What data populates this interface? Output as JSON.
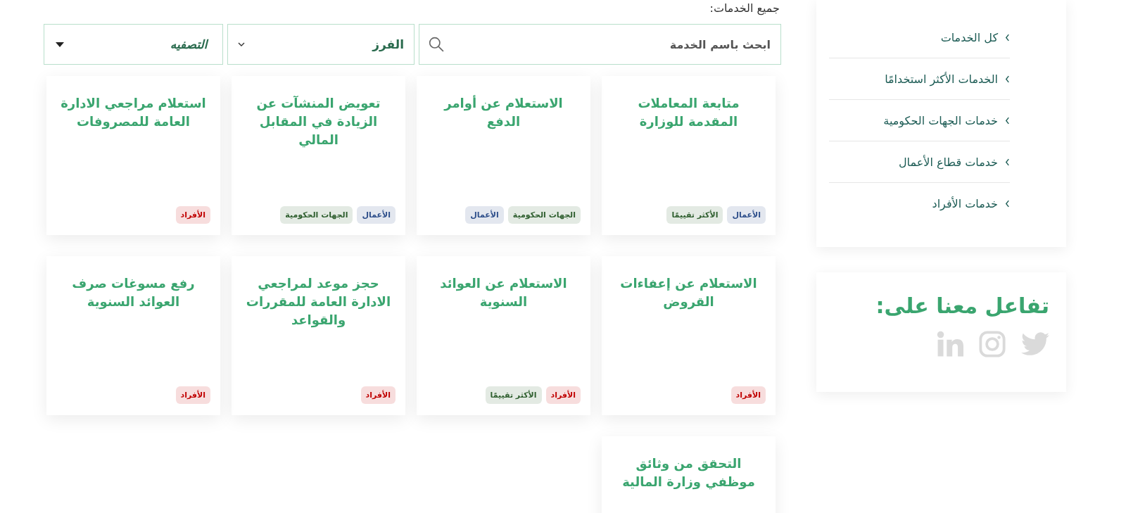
{
  "main": {
    "heading": "جميع الخدمات:",
    "search": {
      "placeholder": "ابحث باسم الخدمة"
    },
    "sort": {
      "value": "الفرز"
    },
    "filter": {
      "value": "التصفيه"
    },
    "services": [
      {
        "title": "متابعة المعاملات المقدمة للوزارة",
        "tags": [
          {
            "label": "الأعمال",
            "color": "#2d4e8a"
          },
          {
            "label": "الأكثر تقييمًا",
            "color": "#2e5e2e"
          }
        ]
      },
      {
        "title": "الاستعلام عن أوامر الدفع",
        "tags": [
          {
            "label": "الجهات الحكومية",
            "color": "#2e5e2e"
          },
          {
            "label": "الأعمال",
            "color": "#2d4e8a"
          }
        ]
      },
      {
        "title": "تعويض المنشآت عن الزيادة في المقابل المالي",
        "tags": [
          {
            "label": "الأعمال",
            "color": "#2d4e8a"
          },
          {
            "label": "الجهات الحكومية",
            "color": "#2e5e2e"
          }
        ]
      },
      {
        "title": "استعلام مراجعي الادارة العامة للمصروفات",
        "tags": [
          {
            "label": "الأفراد",
            "color": "#c00000"
          }
        ]
      },
      {
        "title": "الاستعلام عن إعفاءات القروض",
        "tags": [
          {
            "label": "الأفراد",
            "color": "#c00000"
          }
        ]
      },
      {
        "title": "الاستعلام عن العوائد السنوية",
        "tags": [
          {
            "label": "الأفراد",
            "color": "#c00000"
          },
          {
            "label": "الأكثر تقييمًا",
            "color": "#2e5e2e"
          }
        ]
      },
      {
        "title": "حجز موعد لمراجعي الادارة العامة للمقررات والقواعد",
        "tags": [
          {
            "label": "الأفراد",
            "color": "#c00000"
          }
        ]
      },
      {
        "title": "رفع مسوغات صرف العوائد السنوية",
        "tags": [
          {
            "label": "الأفراد",
            "color": "#c00000"
          }
        ]
      },
      {
        "title": "التحقق من وثائق موظفي وزارة المالية"
      }
    ]
  },
  "sidebar": {
    "menu": [
      {
        "label": "كل الخدمات"
      },
      {
        "label": "الخدمات الأكثر استخدامًا"
      },
      {
        "label": "خدمات الجهات الحكومية"
      },
      {
        "label": "خدمات قطاع الأعمال"
      },
      {
        "label": "خدمات الأفراد"
      }
    ],
    "social": {
      "title": "تفاعل معنا على:",
      "links": [
        {
          "kind": "twitter"
        },
        {
          "kind": "instagram"
        },
        {
          "kind": "linkedin"
        }
      ]
    }
  }
}
